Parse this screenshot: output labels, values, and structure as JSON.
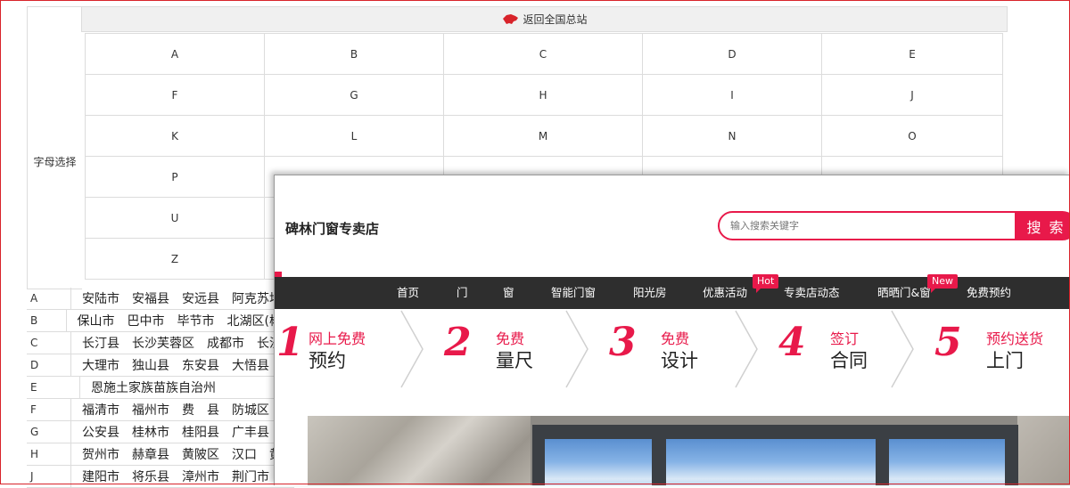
{
  "selector": {
    "back_link": "返回全国总站",
    "letter_label": "字母选择",
    "letters": [
      [
        "A",
        "B",
        "C",
        "D",
        "E"
      ],
      [
        "F",
        "G",
        "H",
        "I",
        "J"
      ],
      [
        "K",
        "L",
        "M",
        "N",
        "O"
      ],
      [
        "P",
        "",
        "",
        "",
        ""
      ],
      [
        "U",
        "",
        "",
        "",
        ""
      ],
      [
        "Z",
        "",
        "",
        "",
        ""
      ]
    ],
    "rows": [
      {
        "letter": "A",
        "cities": "安陆市　安福县　安远县　阿克苏地区"
      },
      {
        "letter": "B",
        "cities": "保山市　巴中市　毕节市　北湖区(郴州"
      },
      {
        "letter": "C",
        "cities": "长汀县　长沙芙蓉区　成都市　长沙雨"
      },
      {
        "letter": "D",
        "cities": "大理市　独山县　东安县　大悟县　丹"
      },
      {
        "letter": "E",
        "cities": "恩施土家族苗族自治州"
      },
      {
        "letter": "F",
        "cities": "福清市　福州市　费　县　防城区　抚"
      },
      {
        "letter": "G",
        "cities": "公安县　桂林市　桂阳县　广丰县　赣"
      },
      {
        "letter": "H",
        "cities": "贺州市　赫章县　黄陂区　汉口　黄石"
      },
      {
        "letter": "J",
        "cities": "建阳市　将乐县　漳州市　荆门市　江"
      }
    ]
  },
  "store": {
    "name": "碑林门窗专卖店",
    "search_placeholder": "输入搜索关键字",
    "search_button": "搜 索",
    "nav": [
      {
        "label": "首页"
      },
      {
        "label": "门"
      },
      {
        "label": "窗"
      },
      {
        "label": "智能门窗"
      },
      {
        "label": "阳光房"
      },
      {
        "label": "优惠活动",
        "badge": "Hot"
      },
      {
        "label": "专卖店动态"
      },
      {
        "label": "晒晒门&窗",
        "badge": "New"
      },
      {
        "label": "免费预约"
      }
    ],
    "steps": [
      {
        "num": "1",
        "line1": "网上免费",
        "line2": "预约"
      },
      {
        "num": "2",
        "line1": "免费",
        "line2": "量尺"
      },
      {
        "num": "3",
        "line1": "免费",
        "line2": "设计"
      },
      {
        "num": "4",
        "line1": "签订",
        "line2": "合同"
      },
      {
        "num": "5",
        "line1": "预约送货",
        "line2": "上门"
      }
    ]
  },
  "colors": {
    "accent": "#e8194a",
    "nav_bg": "#2e2e2e",
    "border": "#dcdcdc"
  }
}
